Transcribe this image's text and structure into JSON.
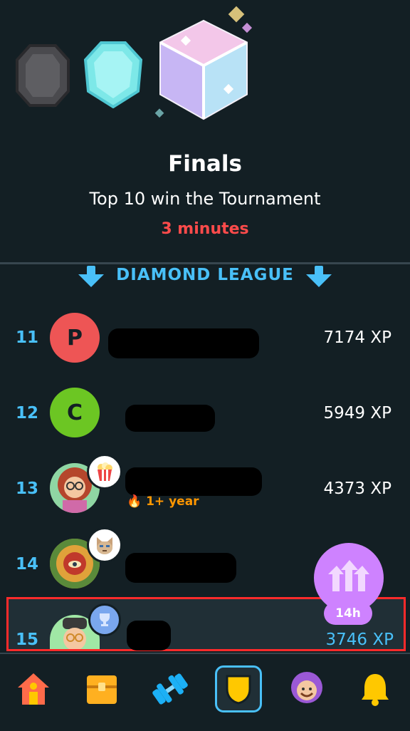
{
  "header": {
    "title": "Finals",
    "subtitle": "Top 10 win the Tournament",
    "time_left": "3 minutes"
  },
  "league": {
    "name": "DIAMOND LEAGUE"
  },
  "leaderboard": [
    {
      "rank": "11",
      "initial": "P",
      "avatar_color": "#ee5555",
      "xp": "7174 XP"
    },
    {
      "rank": "12",
      "initial": "C",
      "avatar_color": "#6cc623",
      "xp": "5949 XP"
    },
    {
      "rank": "13",
      "initial": "",
      "avatar_color": "#8fd6a3",
      "xp": "4373 XP",
      "streak": "1+ year",
      "badge": "popcorn-icon"
    },
    {
      "rank": "14",
      "initial": "",
      "avatar_color": "#c08a2c",
      "xp": "",
      "badge": "cat-icon"
    },
    {
      "rank": "15",
      "initial": "",
      "avatar_color": "#a0e7a5",
      "xp": "3746 XP",
      "badge": "trophy-icon"
    }
  ],
  "promo": {
    "label": "14h"
  },
  "nav": [
    "home-icon",
    "chest-icon",
    "dumbbell-icon",
    "shield-icon",
    "profile-icon",
    "bell-icon"
  ],
  "colors": {
    "accent": "#49c0f8",
    "danger": "#ff4b4b",
    "background": "#131f24"
  }
}
